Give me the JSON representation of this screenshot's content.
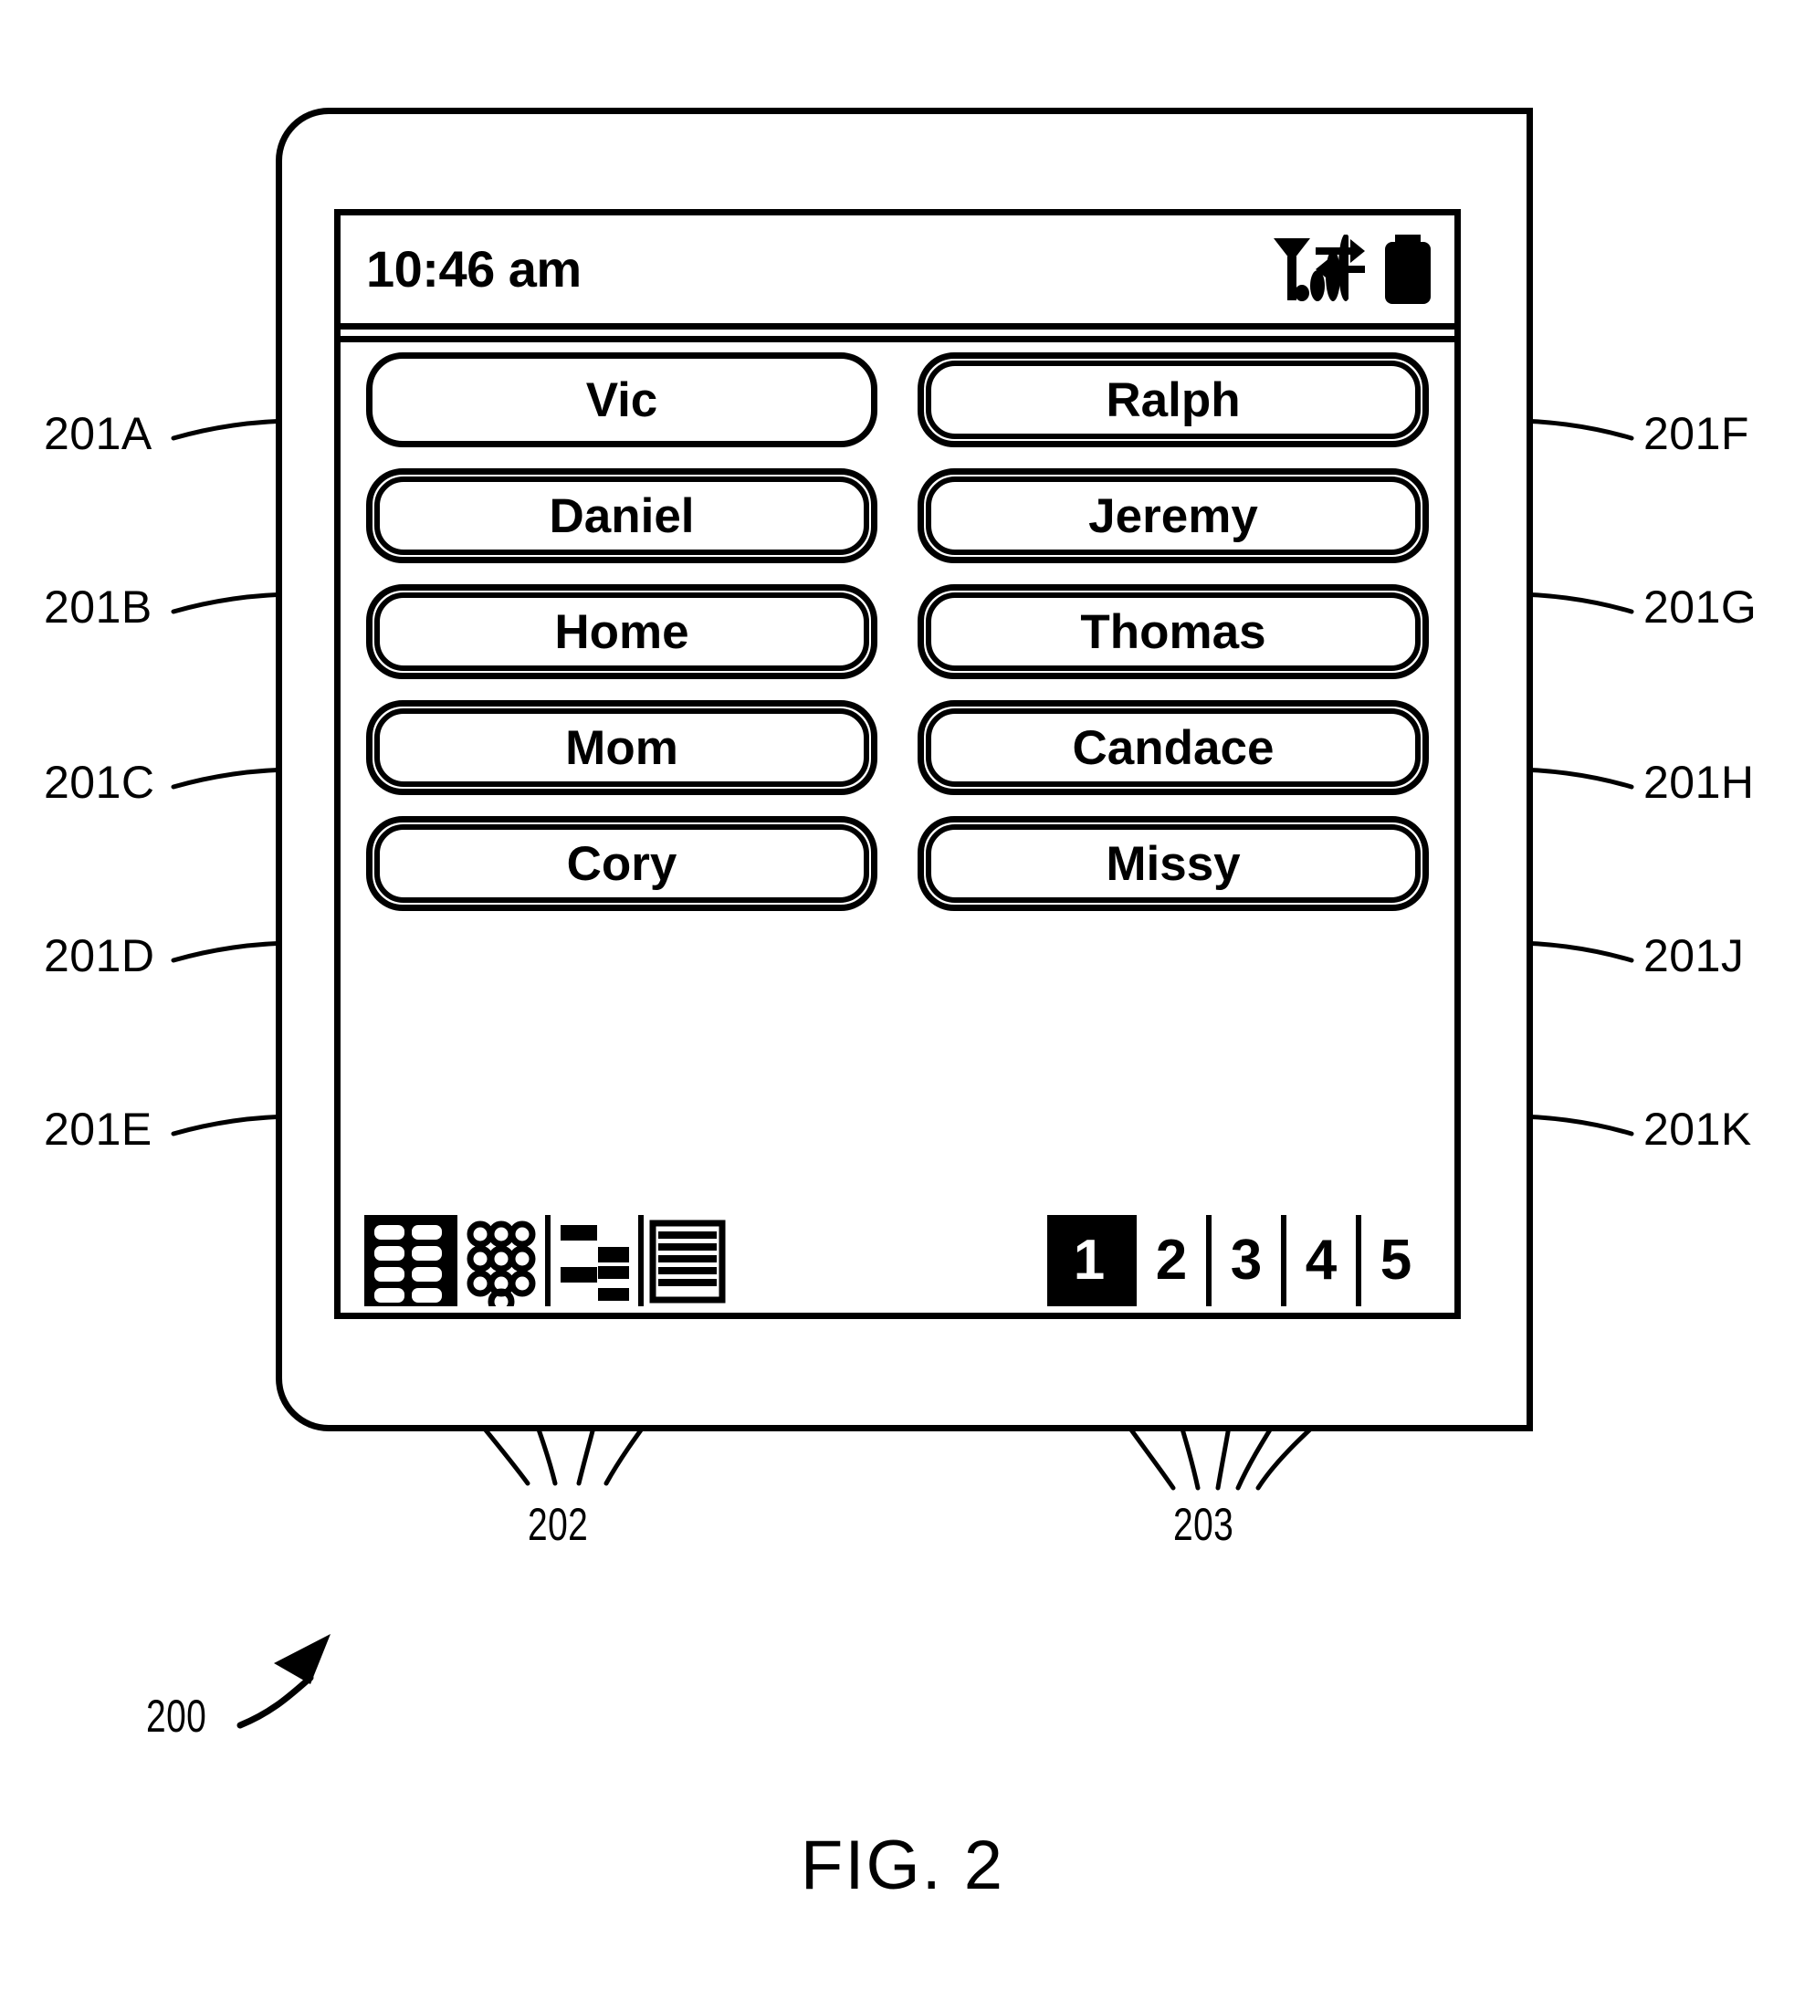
{
  "figure": {
    "caption": "FIG. 2",
    "device_ref": "200",
    "mode_bar_ref": "202",
    "page_bar_ref": "203"
  },
  "status_bar": {
    "time": "10:46 am",
    "icons": [
      {
        "name": "signal-strength-icon",
        "label": "signal-strength"
      },
      {
        "name": "data-transfer-icon",
        "label": "data-transfer"
      },
      {
        "name": "battery-icon",
        "label": "battery"
      }
    ]
  },
  "speed_dial": {
    "left_column": [
      {
        "ref": "201A",
        "label": "Vic",
        "style": "single"
      },
      {
        "ref": "201B",
        "label": "Daniel",
        "style": "double"
      },
      {
        "ref": "201C",
        "label": "Home",
        "style": "double"
      },
      {
        "ref": "201D",
        "label": "Mom",
        "style": "double"
      },
      {
        "ref": "201E",
        "label": "Cory",
        "style": "double"
      }
    ],
    "right_column": [
      {
        "ref": "201F",
        "label": "Ralph",
        "style": "double"
      },
      {
        "ref": "201G",
        "label": "Jeremy",
        "style": "double"
      },
      {
        "ref": "201H",
        "label": "Thomas",
        "style": "double"
      },
      {
        "ref": "201J",
        "label": "Candace",
        "style": "double"
      },
      {
        "ref": "201K",
        "label": "Missy",
        "style": "double"
      }
    ]
  },
  "mode_bar": {
    "ref": "202",
    "items": [
      {
        "name": "speed-dial-grid-icon",
        "label": "speed-dial-grid",
        "selected": true
      },
      {
        "name": "keypad-icon",
        "label": "keypad",
        "selected": false
      },
      {
        "name": "contacts-icon",
        "label": "contacts",
        "selected": false
      },
      {
        "name": "call-log-icon",
        "label": "call-log",
        "selected": false
      }
    ]
  },
  "page_bar": {
    "ref": "203",
    "pages": [
      {
        "label": "1",
        "selected": true
      },
      {
        "label": "2",
        "selected": false
      },
      {
        "label": "3",
        "selected": false
      },
      {
        "label": "4",
        "selected": false
      },
      {
        "label": "5",
        "selected": false
      }
    ]
  },
  "colors": {
    "ink": "#000000",
    "paper": "#ffffff"
  }
}
